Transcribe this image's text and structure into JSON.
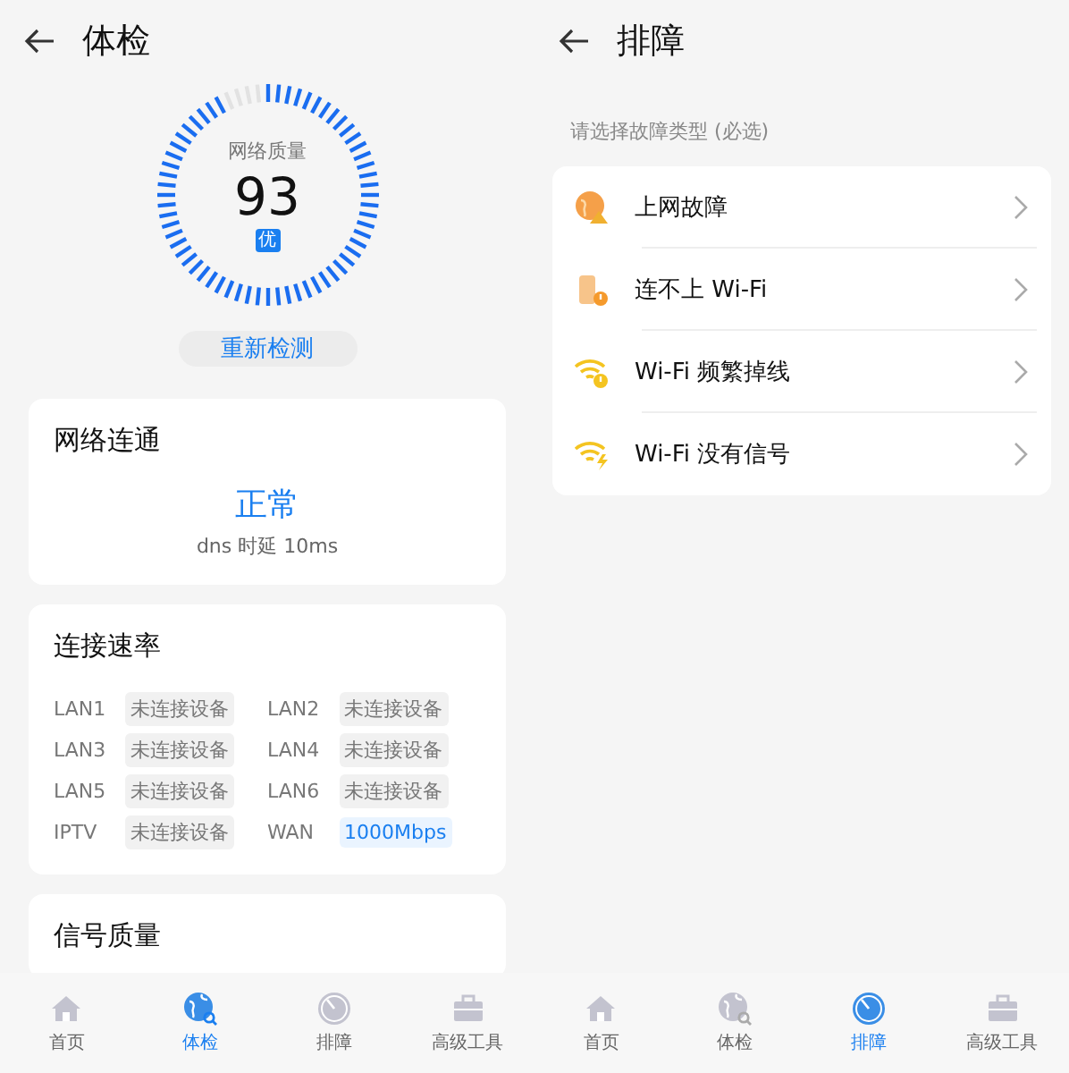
{
  "checkup_screen": {
    "title": "体检",
    "gauge": {
      "label": "网络质量",
      "score": "93",
      "grade": "优",
      "level": 0.93
    },
    "recheck_button": "重新检测",
    "connectivity_card": {
      "title": "网络连通",
      "status": "正常",
      "detail": "dns 时延 10ms"
    },
    "speed_card": {
      "title": "连接速率",
      "ports": [
        {
          "name": "LAN1",
          "value": "未连接设备",
          "connected": false
        },
        {
          "name": "LAN2",
          "value": "未连接设备",
          "connected": false
        },
        {
          "name": "LAN3",
          "value": "未连接设备",
          "connected": false
        },
        {
          "name": "LAN4",
          "value": "未连接设备",
          "connected": false
        },
        {
          "name": "LAN5",
          "value": "未连接设备",
          "connected": false
        },
        {
          "name": "LAN6",
          "value": "未连接设备",
          "connected": false
        },
        {
          "name": "IPTV",
          "value": "未连接设备",
          "connected": false
        },
        {
          "name": "WAN",
          "value": "1000Mbps",
          "connected": true
        }
      ]
    },
    "signal_card": {
      "title": "信号质量"
    },
    "tabs": [
      {
        "label": "首页",
        "kind": "home",
        "selected": false
      },
      {
        "label": "体检",
        "kind": "checkup",
        "selected": true
      },
      {
        "label": "排障",
        "kind": "gauge",
        "selected": false
      },
      {
        "label": "高级工具",
        "kind": "toolbox",
        "selected": false
      }
    ]
  },
  "troubleshoot_screen": {
    "title": "排障",
    "prompt": "请选择故障类型 (必选)",
    "items": [
      {
        "label": "上网故障",
        "kind": "globe"
      },
      {
        "label": "连不上 Wi-Fi",
        "kind": "router"
      },
      {
        "label": "Wi-Fi 频繁掉线",
        "kind": "wifi"
      },
      {
        "label": "Wi-Fi 没有信号",
        "kind": "wifi-bolt"
      }
    ],
    "tabs": [
      {
        "label": "首页",
        "kind": "home",
        "selected": false
      },
      {
        "label": "体检",
        "kind": "checkup",
        "selected": false
      },
      {
        "label": "排障",
        "kind": "gauge",
        "selected": true
      },
      {
        "label": "高级工具",
        "kind": "toolbox",
        "selected": false
      }
    ]
  }
}
